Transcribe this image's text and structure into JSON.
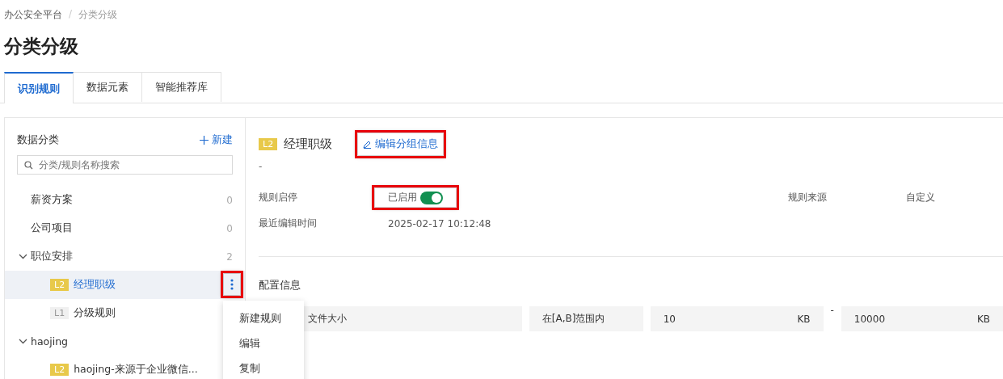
{
  "breadcrumb": [
    {
      "label": "办公安全平台"
    },
    {
      "label": "分类分级"
    }
  ],
  "breadcrumb_separator": "/",
  "page_title": "分类分级",
  "tabs": [
    {
      "label": "识别规则",
      "selected": true
    },
    {
      "label": "数据元素",
      "selected": false
    },
    {
      "label": "智能推荐库",
      "selected": false
    }
  ],
  "sidebar": {
    "title": "数据分类",
    "new_button": "新建",
    "search": {
      "placeholder": "分类/规则名称搜索"
    },
    "tree": [
      {
        "label": "薪资方案",
        "count": "0"
      },
      {
        "label": "公司项目",
        "count": "0"
      },
      {
        "label": "职位安排",
        "count": "2",
        "expanded": true,
        "children": [
          {
            "badge": "L2",
            "color": "#e8c94a",
            "label": "经理职级",
            "selected": true
          },
          {
            "badge": "L1",
            "color": "#f0f0f0",
            "label": "分级规则",
            "selected": false
          }
        ]
      },
      {
        "label": "haojing",
        "expanded": true,
        "children": [
          {
            "badge": "L2",
            "color": "#e8c94a",
            "label": "haojing-来源于企业微信...",
            "selected": false
          }
        ]
      }
    ],
    "more_button": {
      "highlighted": true
    },
    "menu": [
      "新建规则",
      "编辑",
      "复制"
    ]
  },
  "detail": {
    "badge": {
      "label": "L2",
      "color": "#e8c94a"
    },
    "title": "经理职级",
    "edit_link": {
      "label": "编辑分组信息",
      "highlighted": true
    },
    "description": "-",
    "fields": [
      {
        "label": "规则启停",
        "value": "已启用",
        "kind": "toggle",
        "on": true,
        "highlighted": true
      },
      {
        "label": "规则来源",
        "value": "自定义",
        "kind": "text"
      },
      {
        "label": "最近编辑时间",
        "value": "2025-02-17 10:12:48",
        "kind": "text"
      }
    ],
    "config_title": "配置信息",
    "config_row": {
      "field": "文件大小",
      "operator": "在[A,B]范围内",
      "min": "10",
      "min_unit": "KB",
      "separator": "-",
      "max": "10000",
      "max_unit": "KB"
    }
  }
}
